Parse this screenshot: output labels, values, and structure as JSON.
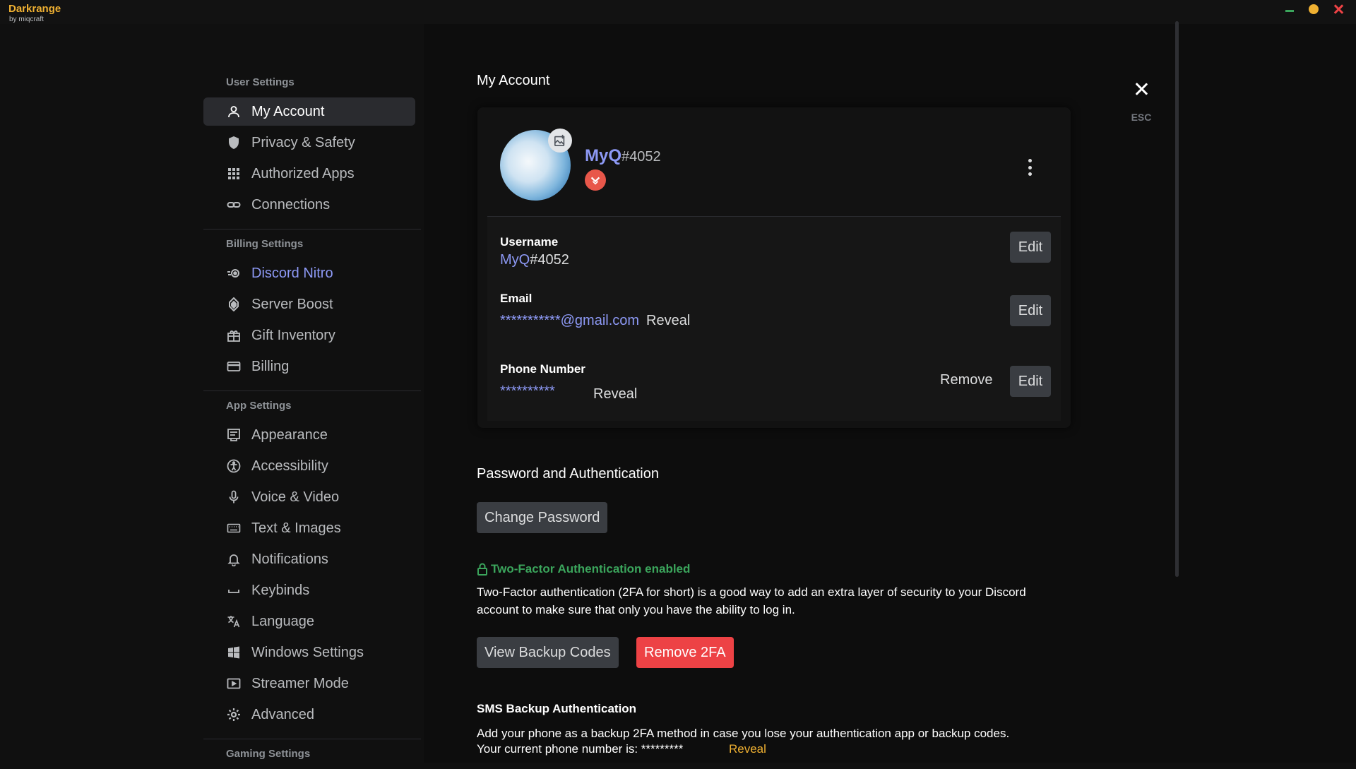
{
  "window": {
    "app_title": "Darkrange",
    "app_subtitle": "by miqcraft"
  },
  "colors": {
    "accent": "#8d99f5",
    "success": "#3ba55c",
    "danger": "#ed4245",
    "warning": "#f0b132"
  },
  "sidebar": {
    "sections": [
      {
        "title": "User Settings",
        "items": [
          {
            "label": "My Account",
            "icon": "user-icon",
            "active": true
          },
          {
            "label": "Privacy & Safety",
            "icon": "shield-icon"
          },
          {
            "label": "Authorized Apps",
            "icon": "grid-icon"
          },
          {
            "label": "Connections",
            "icon": "link-icon"
          }
        ]
      },
      {
        "title": "Billing Settings",
        "items": [
          {
            "label": "Discord Nitro",
            "icon": "nitro-icon"
          },
          {
            "label": "Server Boost",
            "icon": "boost-icon"
          },
          {
            "label": "Gift Inventory",
            "icon": "gift-icon"
          },
          {
            "label": "Billing",
            "icon": "credit-card-icon"
          }
        ]
      },
      {
        "title": "App Settings",
        "items": [
          {
            "label": "Appearance",
            "icon": "palette-icon"
          },
          {
            "label": "Accessibility",
            "icon": "accessibility-icon"
          },
          {
            "label": "Voice & Video",
            "icon": "microphone-icon"
          },
          {
            "label": "Text & Images",
            "icon": "keyboard-icon"
          },
          {
            "label": "Notifications",
            "icon": "bell-icon"
          },
          {
            "label": "Keybinds",
            "icon": "keybind-icon"
          },
          {
            "label": "Language",
            "icon": "translate-icon"
          },
          {
            "label": "Windows Settings",
            "icon": "windows-icon"
          },
          {
            "label": "Streamer Mode",
            "icon": "stream-icon"
          },
          {
            "label": "Advanced",
            "icon": "gear-icon"
          }
        ]
      },
      {
        "title": "Gaming Settings",
        "items": []
      }
    ]
  },
  "main": {
    "title": "My Account",
    "close_label": "ESC",
    "profile": {
      "username": "MyQ",
      "discriminator": "#4052"
    },
    "fields": {
      "username_label": "Username",
      "username_name": "MyQ",
      "username_disc": "#4052",
      "email_label": "Email",
      "email_masked": "***********@gmail.com",
      "phone_label": "Phone Number",
      "phone_masked": "**********",
      "reveal_label": "Reveal",
      "edit_label": "Edit",
      "remove_label": "Remove"
    },
    "password": {
      "title": "Password and Authentication",
      "change_password_label": "Change Password",
      "tfa_status": "Two-Factor Authentication enabled",
      "tfa_description": "Two-Factor authentication (2FA for short) is a good way to add an extra layer of security to your Discord account to make sure that only you have the ability to log in.",
      "view_backup_label": "View Backup Codes",
      "remove_2fa_label": "Remove 2FA",
      "sms_title": "SMS Backup Authentication",
      "sms_description": "Add your phone as a backup 2FA method in case you lose your authentication app or backup codes.",
      "sms_phone_text": "Your current phone number is: *********",
      "sms_reveal_label": "Reveal"
    }
  }
}
